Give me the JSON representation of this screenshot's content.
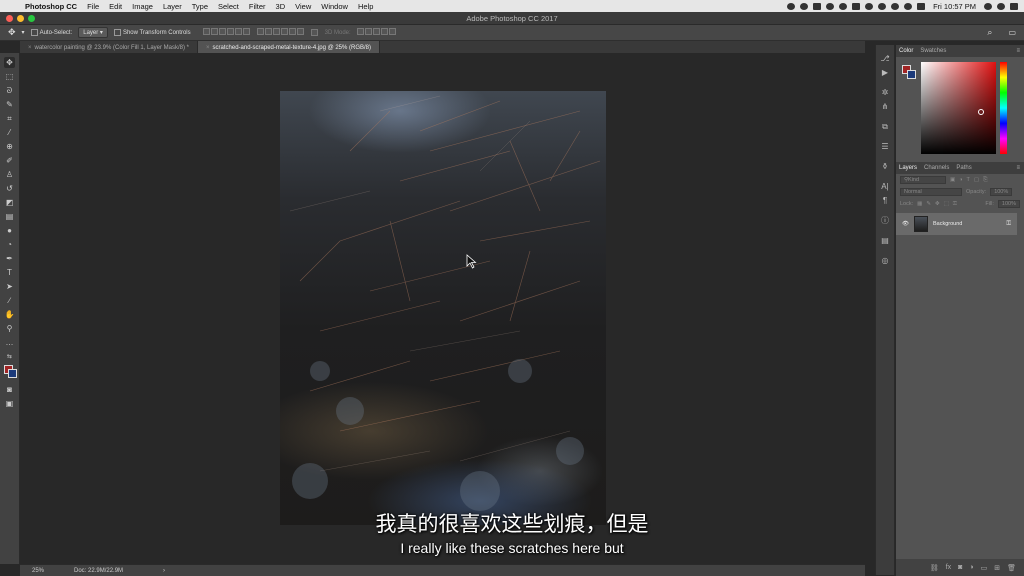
{
  "menubar": {
    "apple": "",
    "app_name": "Photoshop CC",
    "items": [
      "File",
      "Edit",
      "Image",
      "Layer",
      "Type",
      "Select",
      "Filter",
      "3D",
      "View",
      "Window",
      "Help"
    ],
    "clock": "Fri 10:57 PM"
  },
  "window": {
    "title": "Adobe Photoshop CC 2017"
  },
  "options": {
    "auto_select_label": "Auto-Select:",
    "auto_select_value": "Layer",
    "show_transform_label": "Show Transform Controls",
    "mode_3d": "3D Mode:"
  },
  "tabs": [
    {
      "label": "watercolor painting @ 23.9% (Color Fill 1, Layer Mask/8) *",
      "close": "×"
    },
    {
      "label": "scratched-and-scraped-metal-texture-4.jpg @ 25% (RGB/8)",
      "close": "×"
    }
  ],
  "status": {
    "zoom": "25%",
    "doc": "Doc: 22.9M/22.9M",
    "arrow": "›"
  },
  "color_panel": {
    "tabs": [
      "Color",
      "Swatches"
    ],
    "foreground": "#a12424",
    "background": "#1c3a7a"
  },
  "layers_panel": {
    "tabs": [
      "Layers",
      "Channels",
      "Paths"
    ],
    "kind_placeholder": "Kind",
    "blend_mode": "Normal",
    "opacity_label": "Opacity:",
    "opacity_value": "100%",
    "lock_label": "Lock:",
    "fill_label": "Fill:",
    "fill_value": "100%",
    "layers": [
      {
        "name": "Background",
        "visible": true,
        "locked": true
      }
    ]
  },
  "subtitles": {
    "zh": "我真的很喜欢这些划痕，但是",
    "en": "I really like these scratches here but"
  }
}
